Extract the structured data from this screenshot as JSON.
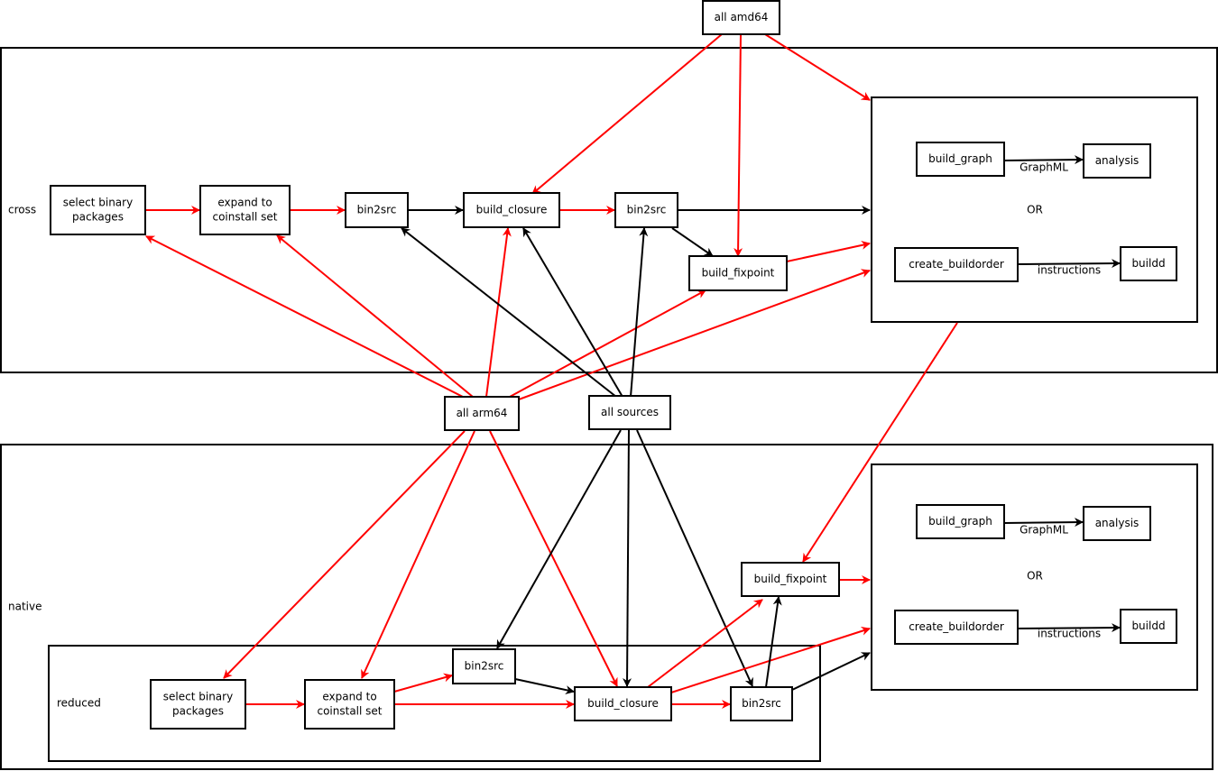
{
  "colors": {
    "red_edge": "#ff0000",
    "black_edge": "#000000"
  },
  "frames": {
    "cross": {
      "label": "cross"
    },
    "native": {
      "label": "native"
    },
    "reduced": {
      "label": "reduced"
    },
    "cross_output": {
      "label": "OR"
    },
    "native_output": {
      "label": "OR"
    }
  },
  "nodes": {
    "all_amd64": {
      "label": [
        "all amd64"
      ]
    },
    "all_arm64": {
      "label": [
        "all arm64"
      ]
    },
    "all_sources": {
      "label": [
        "all sources"
      ]
    },
    "c_select": {
      "label": [
        "select binary",
        "packages"
      ]
    },
    "c_expand": {
      "label": [
        "expand to",
        "coinstall set"
      ]
    },
    "c_bin2src1": {
      "label": [
        "bin2src"
      ]
    },
    "c_closure": {
      "label": [
        "build_closure"
      ]
    },
    "c_bin2src2": {
      "label": [
        "bin2src"
      ]
    },
    "c_fixpoint": {
      "label": [
        "build_fixpoint"
      ]
    },
    "c_build_graph": {
      "label": [
        "build_graph"
      ]
    },
    "c_analysis": {
      "label": [
        "analysis"
      ]
    },
    "c_create_buildorder": {
      "label": [
        "create_buildorder"
      ]
    },
    "c_buildd": {
      "label": [
        "buildd"
      ]
    },
    "n_select": {
      "label": [
        "select binary",
        "packages"
      ]
    },
    "n_expand": {
      "label": [
        "expand to",
        "coinstall set"
      ]
    },
    "n_bin2src1": {
      "label": [
        "bin2src"
      ]
    },
    "n_closure": {
      "label": [
        "build_closure"
      ]
    },
    "n_bin2src2": {
      "label": [
        "bin2src"
      ]
    },
    "n_fixpoint": {
      "label": [
        "build_fixpoint"
      ]
    },
    "n_build_graph": {
      "label": [
        "build_graph"
      ]
    },
    "n_analysis": {
      "label": [
        "analysis"
      ]
    },
    "n_create_buildorder": {
      "label": [
        "create_buildorder"
      ]
    },
    "n_buildd": {
      "label": [
        "buildd"
      ]
    }
  },
  "edge_labels": {
    "graphml": "GraphML",
    "instructions": "instructions"
  },
  "edges": [
    {
      "from": "c_select",
      "to": "c_expand",
      "color": "red"
    },
    {
      "from": "c_expand",
      "to": "c_bin2src1",
      "color": "red"
    },
    {
      "from": "c_bin2src1",
      "to": "c_closure",
      "color": "black"
    },
    {
      "from": "c_closure",
      "to": "c_bin2src2",
      "color": "red"
    },
    {
      "from": "c_bin2src2",
      "to": "cross_output",
      "color": "black"
    },
    {
      "from": "c_bin2src2",
      "to": "c_fixpoint",
      "color": "black"
    },
    {
      "from": "c_fixpoint",
      "to": "cross_output",
      "color": "red"
    },
    {
      "from": "all_amd64",
      "to": "c_closure",
      "color": "red"
    },
    {
      "from": "all_amd64",
      "to": "c_fixpoint",
      "color": "red"
    },
    {
      "from": "all_amd64",
      "to": "cross_output",
      "color": "red"
    },
    {
      "from": "all_arm64",
      "to": "c_select",
      "color": "red"
    },
    {
      "from": "all_arm64",
      "to": "c_expand",
      "color": "red"
    },
    {
      "from": "all_arm64",
      "to": "c_closure",
      "color": "red"
    },
    {
      "from": "all_arm64",
      "to": "c_fixpoint",
      "color": "red"
    },
    {
      "from": "all_arm64",
      "to": "cross_output",
      "color": "red"
    },
    {
      "from": "all_sources",
      "to": "c_bin2src1",
      "color": "black"
    },
    {
      "from": "all_sources",
      "to": "c_closure",
      "color": "black"
    },
    {
      "from": "all_sources",
      "to": "c_bin2src2",
      "color": "black"
    },
    {
      "from": "c_build_graph",
      "to": "c_analysis",
      "color": "black",
      "label": "GraphML"
    },
    {
      "from": "c_create_buildorder",
      "to": "c_buildd",
      "color": "black",
      "label": "instructions"
    },
    {
      "from": "cross_output",
      "to": "n_fixpoint",
      "color": "red"
    },
    {
      "from": "all_arm64",
      "to": "n_select",
      "color": "red"
    },
    {
      "from": "all_arm64",
      "to": "n_expand",
      "color": "red"
    },
    {
      "from": "all_arm64",
      "to": "n_closure",
      "color": "red"
    },
    {
      "from": "all_sources",
      "to": "n_bin2src1",
      "color": "black"
    },
    {
      "from": "all_sources",
      "to": "n_closure",
      "color": "black"
    },
    {
      "from": "all_sources",
      "to": "n_bin2src2",
      "color": "black"
    },
    {
      "from": "n_select",
      "to": "n_expand",
      "color": "red"
    },
    {
      "from": "n_expand",
      "to": "n_bin2src1",
      "color": "red"
    },
    {
      "from": "n_expand",
      "to": "n_closure",
      "color": "red"
    },
    {
      "from": "n_bin2src1",
      "to": "n_closure",
      "color": "black"
    },
    {
      "from": "n_closure",
      "to": "n_bin2src2",
      "color": "red"
    },
    {
      "from": "n_closure",
      "to": "n_fixpoint",
      "color": "red"
    },
    {
      "from": "n_closure",
      "to": "native_output",
      "color": "red"
    },
    {
      "from": "n_bin2src2",
      "to": "n_fixpoint",
      "color": "black"
    },
    {
      "from": "n_bin2src2",
      "to": "native_output",
      "color": "black"
    },
    {
      "from": "n_fixpoint",
      "to": "native_output",
      "color": "red"
    },
    {
      "from": "n_build_graph",
      "to": "n_analysis",
      "color": "black",
      "label": "GraphML"
    },
    {
      "from": "n_create_buildorder",
      "to": "n_buildd",
      "color": "black",
      "label": "instructions"
    }
  ]
}
